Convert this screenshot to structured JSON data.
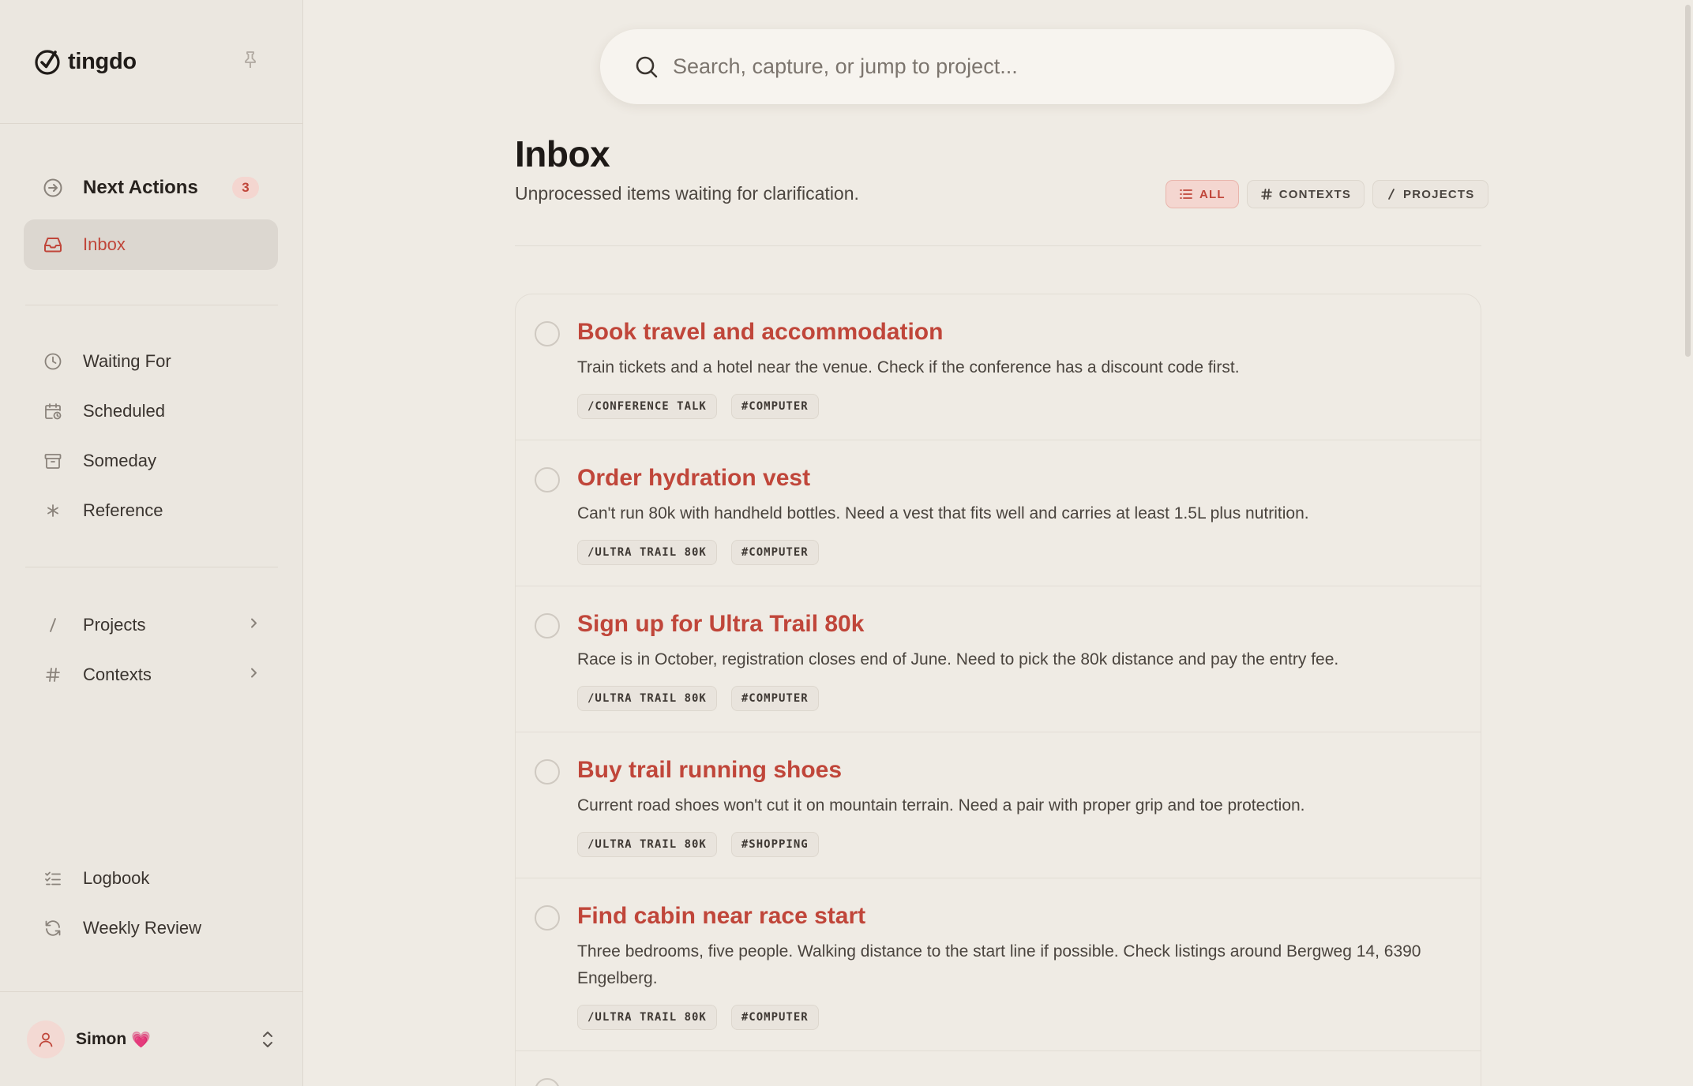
{
  "brand": {
    "name": "tingdo"
  },
  "sidebar": {
    "primary": [
      {
        "label": "Next Actions",
        "badge": "3",
        "icon": "arrow-circle-icon"
      },
      {
        "label": "Inbox",
        "icon": "inbox-icon",
        "active": true
      }
    ],
    "lists": [
      {
        "label": "Waiting For",
        "icon": "clock-icon"
      },
      {
        "label": "Scheduled",
        "icon": "calendar-clock-icon"
      },
      {
        "label": "Someday",
        "icon": "archive-icon"
      },
      {
        "label": "Reference",
        "icon": "asterisk-icon"
      }
    ],
    "groups": [
      {
        "label": "Projects",
        "icon": "slash-icon"
      },
      {
        "label": "Contexts",
        "icon": "hash-icon"
      }
    ],
    "footer": [
      {
        "label": "Logbook",
        "icon": "checklist-icon"
      },
      {
        "label": "Weekly Review",
        "icon": "refresh-icon"
      }
    ],
    "user": {
      "name": "Simon",
      "emoji": "💗"
    }
  },
  "search": {
    "placeholder": "Search, capture, or jump to project..."
  },
  "page": {
    "title": "Inbox",
    "subtitle": "Unprocessed items waiting for clarification."
  },
  "filters": [
    {
      "label": "ALL",
      "active": true
    },
    {
      "label": "CONTEXTS"
    },
    {
      "label": "PROJECTS"
    }
  ],
  "tasks": [
    {
      "title": "Book travel and accommodation",
      "desc": "Train tickets and a hotel near the venue. Check if the conference has a discount code first.",
      "tags": [
        "/CONFERENCE TALK",
        "#COMPUTER"
      ]
    },
    {
      "title": "Order hydration vest",
      "desc": "Can't run 80k with handheld bottles. Need a vest that fits well and carries at least 1.5L plus nutrition.",
      "tags": [
        "/ULTRA TRAIL 80K",
        "#COMPUTER"
      ]
    },
    {
      "title": "Sign up for Ultra Trail 80k",
      "desc": "Race is in October, registration closes end of June. Need to pick the 80k distance and pay the entry fee.",
      "tags": [
        "/ULTRA TRAIL 80K",
        "#COMPUTER"
      ]
    },
    {
      "title": "Buy trail running shoes",
      "desc": "Current road shoes won't cut it on mountain terrain. Need a pair with proper grip and toe protection.",
      "tags": [
        "/ULTRA TRAIL 80K",
        "#SHOPPING"
      ]
    },
    {
      "title": "Find cabin near race start",
      "desc": "Three bedrooms, five people. Walking distance to the start line if possible. Check listings around Bergweg 14, 6390 Engelberg.",
      "tags": [
        "/ULTRA TRAIL 80K",
        "#COMPUTER"
      ]
    }
  ]
}
